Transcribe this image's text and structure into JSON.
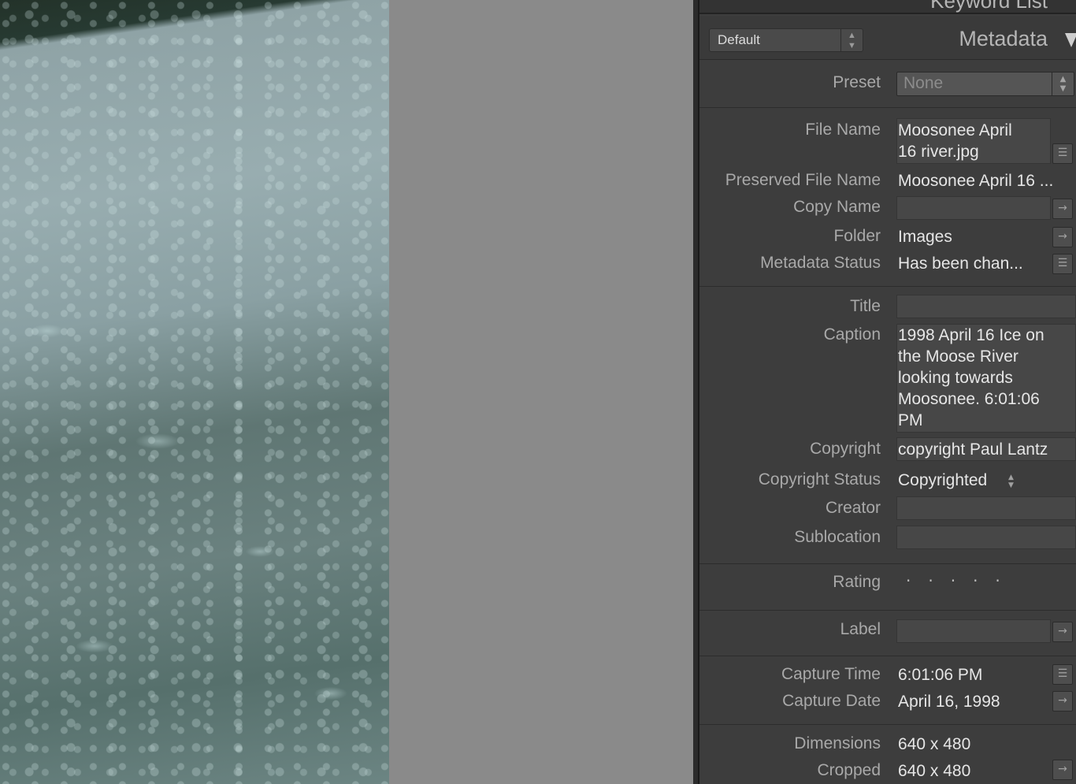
{
  "panel": {
    "keyword_list_title": "Keyword List",
    "preset_selector": "Default",
    "metadata_title": "Metadata"
  },
  "fields": {
    "preset_label": "Preset",
    "preset_value": "None",
    "file_name_label": "File Name",
    "file_name_line1": "Moosonee April",
    "file_name_line2": "16 river.jpg",
    "preserved_label": "Preserved File Name",
    "preserved_value": "Moosonee April 16 ...",
    "copy_name_label": "Copy Name",
    "copy_name_value": "",
    "folder_label": "Folder",
    "folder_value": "Images",
    "metadata_status_label": "Metadata Status",
    "metadata_status_value": "Has been chan...",
    "title_label": "Title",
    "title_value": "",
    "caption_label": "Caption",
    "caption_lines": [
      "1998 April 16 Ice on",
      "the Moose River",
      "looking towards",
      "Moosonee. 6:01:06",
      "PM"
    ],
    "copyright_label": "Copyright",
    "copyright_value": "copyright Paul Lantz",
    "copyright_status_label": "Copyright Status",
    "copyright_status_value": "Copyrighted",
    "creator_label": "Creator",
    "creator_value": "",
    "sublocation_label": "Sublocation",
    "sublocation_value": "",
    "rating_label": "Rating",
    "rating_value": 0,
    "label_label": "Label",
    "label_value": "",
    "capture_time_label": "Capture Time",
    "capture_time_value": "6:01:06 PM",
    "capture_date_label": "Capture Date",
    "capture_date_value": "April 16, 1998",
    "dimensions_label": "Dimensions",
    "dimensions_value": "640 x 480",
    "cropped_label": "Cropped",
    "cropped_value": "640 x 480"
  }
}
